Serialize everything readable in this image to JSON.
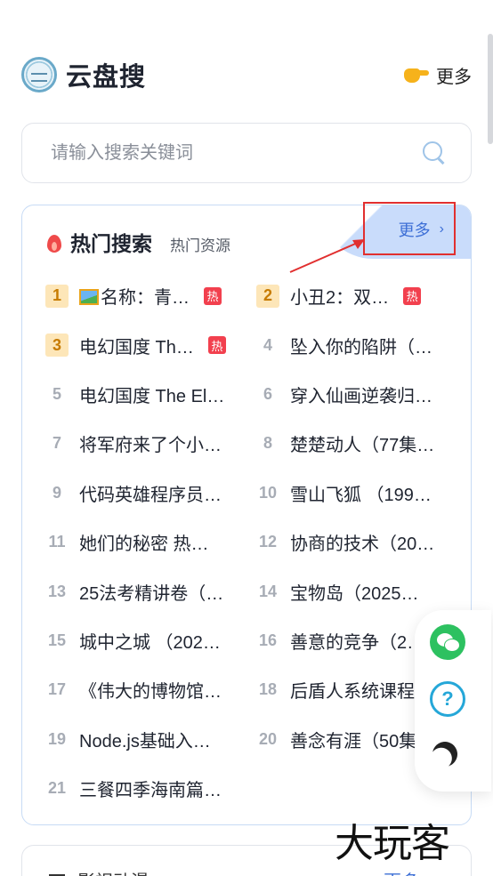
{
  "header": {
    "app_title": "云盘搜",
    "more_label": "更多"
  },
  "search": {
    "placeholder": "请输入搜索关键词"
  },
  "hot": {
    "title": "热门搜索",
    "subtitle": "热门资源",
    "more_label": "更多",
    "hot_badge": "热",
    "items": [
      {
        "rank": "1",
        "title": "名称：青…",
        "hot": true,
        "image_icon": true
      },
      {
        "rank": "2",
        "title": "小丑2：双…",
        "hot": true
      },
      {
        "rank": "3",
        "title": "电幻国度 Th…",
        "hot": true
      },
      {
        "rank": "4",
        "title": "坠入你的陷阱（…"
      },
      {
        "rank": "5",
        "title": "电幻国度 The El…"
      },
      {
        "rank": "6",
        "title": "穿入仙画逆袭归…"
      },
      {
        "rank": "7",
        "title": "将军府来了个小…"
      },
      {
        "rank": "8",
        "title": "楚楚动人（77集…"
      },
      {
        "rank": "9",
        "title": "代码英雄程序员…"
      },
      {
        "rank": "10",
        "title": "雪山飞狐 （199…"
      },
      {
        "rank": "11",
        "title": "她们的秘密 热…"
      },
      {
        "rank": "12",
        "title": "协商的技术（20…"
      },
      {
        "rank": "13",
        "title": "25法考精讲卷（…"
      },
      {
        "rank": "14",
        "title": "宝物岛（2025…"
      },
      {
        "rank": "15",
        "title": "城中之城 （202…"
      },
      {
        "rank": "16",
        "title": "善意的竞争（2…"
      },
      {
        "rank": "17",
        "title": "《伟大的博物馆…"
      },
      {
        "rank": "18",
        "title": "后盾人系统课程…"
      },
      {
        "rank": "19",
        "title": "Node.js基础入…"
      },
      {
        "rank": "20",
        "title": "善念有涯（50集…"
      },
      {
        "rank": "21",
        "title": "三餐四季海南篇…"
      }
    ]
  },
  "next_section": {
    "title": "影视动漫",
    "more_label": "更多"
  },
  "watermark": "大玩客",
  "colors": {
    "accent": "#3d6fd6",
    "hot": "#f2404e",
    "top_rank_bg": "#fde6b8",
    "annotation": "#e12f2f"
  }
}
